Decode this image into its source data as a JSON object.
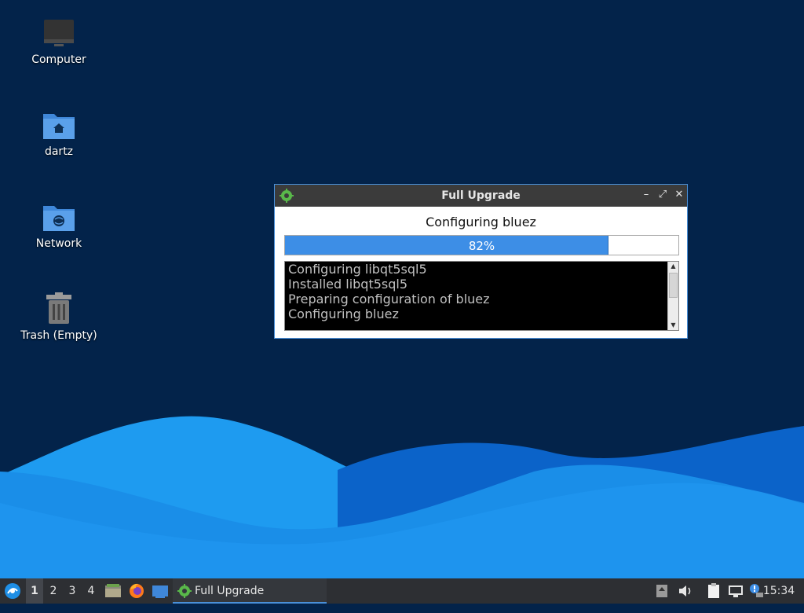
{
  "desktop": {
    "icons": [
      {
        "label": "Computer",
        "icon": "computer-icon"
      },
      {
        "label": "dartz",
        "icon": "home-folder-icon"
      },
      {
        "label": "Network",
        "icon": "network-folder-icon"
      },
      {
        "label": "Trash (Empty)",
        "icon": "trash-icon"
      }
    ],
    "colors": {
      "background": "#03234a",
      "wave_light": "#1e9bf0",
      "wave_dark": "#0a5fc4"
    }
  },
  "window": {
    "title": "Full Upgrade",
    "icon": "gear-icon",
    "status": "Configuring bluez",
    "progress": {
      "value": 82,
      "label": "82%"
    },
    "log_lines": [
      "Configuring libqt5sql5",
      "Installed libqt5sql5",
      "Preparing configuration of bluez",
      "Configuring bluez"
    ],
    "controls": {
      "minimize": "–",
      "maximize": "⤢",
      "close": "✕"
    }
  },
  "taskbar": {
    "workspaces": [
      "1",
      "2",
      "3",
      "4"
    ],
    "active_workspace": "1",
    "launchers": [
      "file-manager-icon",
      "firefox-icon",
      "desktop-icon"
    ],
    "task": {
      "label": "Full Upgrade",
      "icon": "gear-icon"
    },
    "tray": [
      "tray-up-arrow-icon",
      "volume-icon",
      "clipboard-icon",
      "network-icon",
      "update-notifier-icon"
    ],
    "clock": "15:34"
  }
}
